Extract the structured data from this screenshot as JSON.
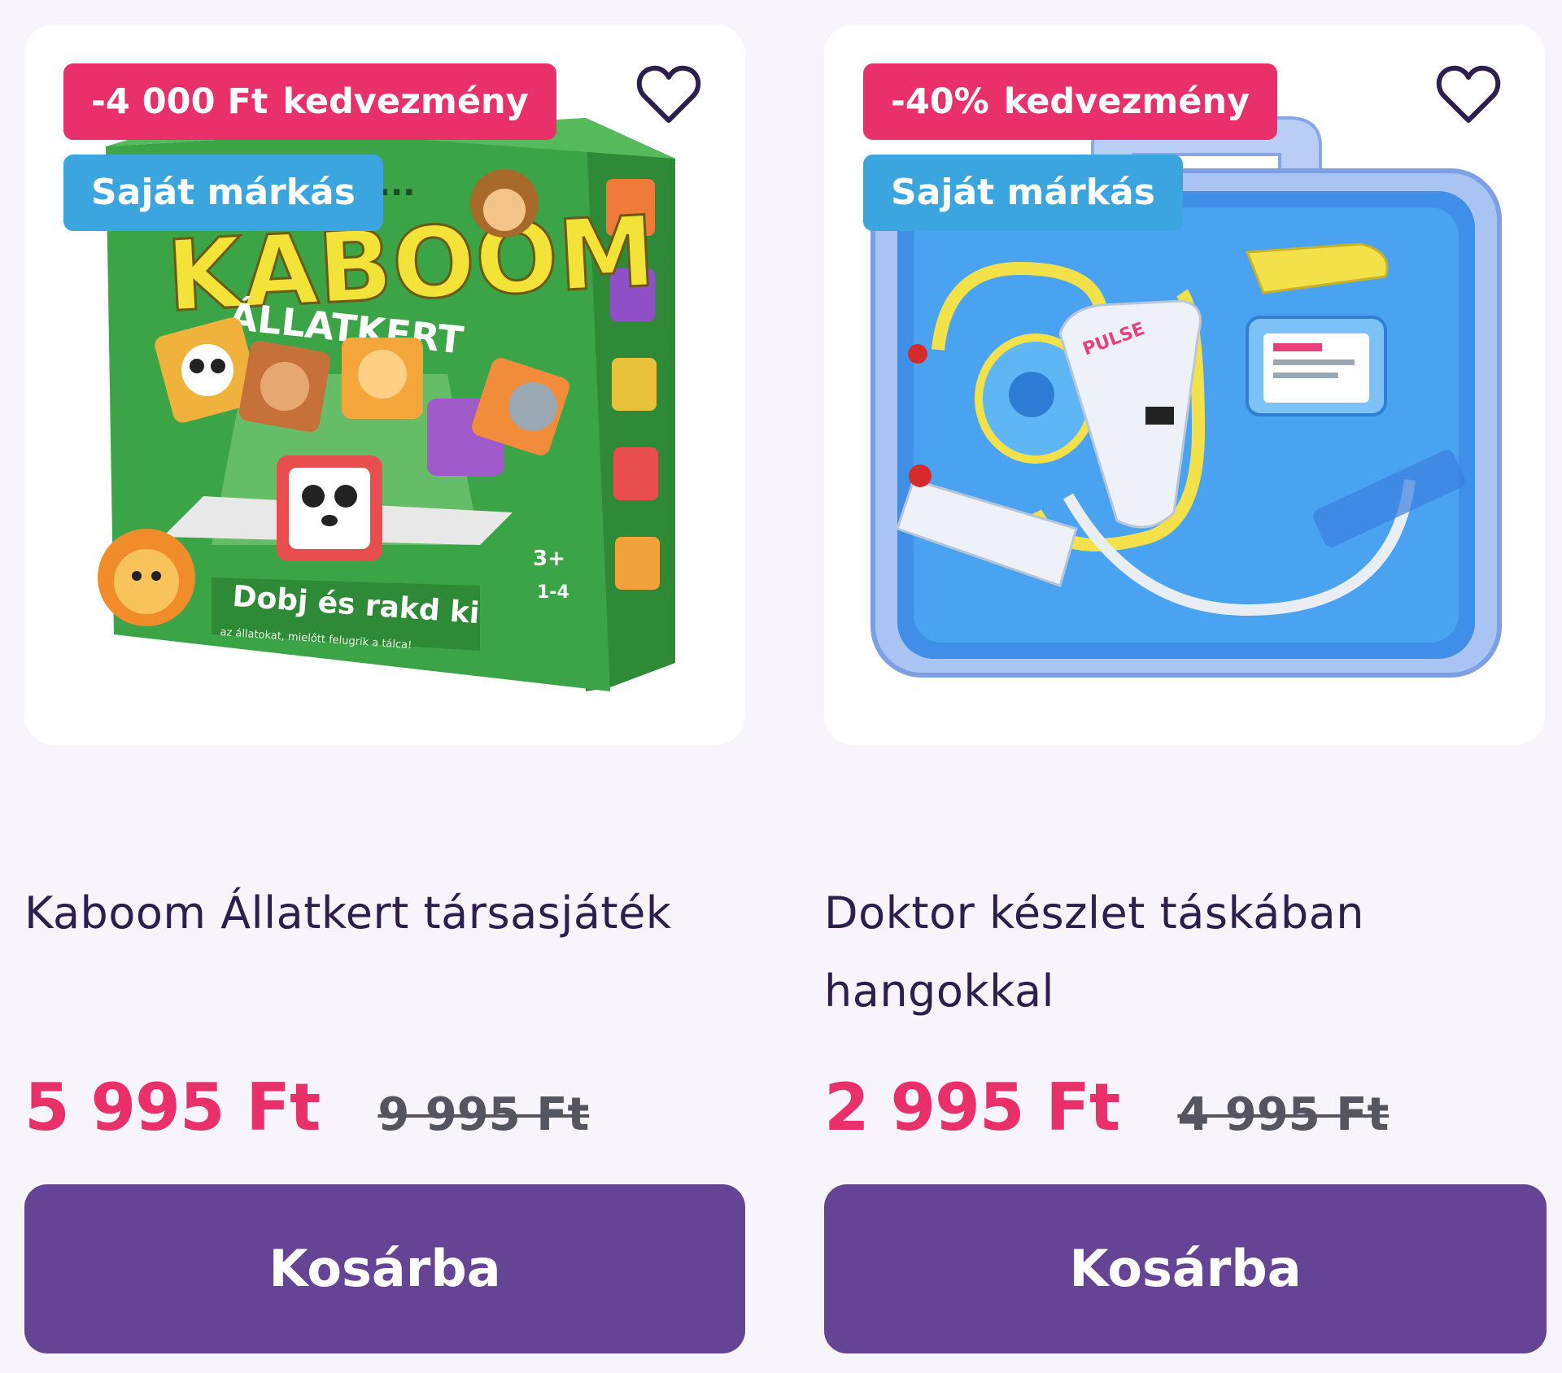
{
  "colors": {
    "page_bg": "#f7f4fc",
    "discount_badge": "#e9306b",
    "own_brand_badge": "#3aa5de",
    "price": "#e9306b",
    "cart_button": "#654496",
    "title_text": "#2c1f4d"
  },
  "products": [
    {
      "discount_amount": "-4 000 Ft",
      "discount_label": "kedvezmény",
      "brand_badge": "Saját márkás",
      "image_icon": "board-game-box-image",
      "wishlist_icon": "heart-outline-icon",
      "title": "Kaboom Állatkert társasjáték",
      "price": "5 995 Ft",
      "old_price": "9 995 Ft",
      "cart_label": "Kosárba",
      "box_art": {
        "top_text": "Ű..AK...",
        "logo_text": "KABOOM",
        "subtitle": "ÁLLATKERT",
        "banner": "Dobj és rakd ki",
        "banner_sub": "az állatokat, mielőtt felugrik a tálca!",
        "age": "3+",
        "players": "1-4"
      }
    },
    {
      "discount_amount": "-40%",
      "discount_label": "kedvezmény",
      "brand_badge": "Saját márkás",
      "image_icon": "doctor-kit-case-image",
      "wishlist_icon": "heart-outline-icon",
      "title": "Doktor készlet táskában hangokkal",
      "price": "2 995 Ft",
      "old_price": "4 995 Ft",
      "cart_label": "Kosárba",
      "box_art": {
        "pulse_label": "PULSE"
      }
    }
  ]
}
